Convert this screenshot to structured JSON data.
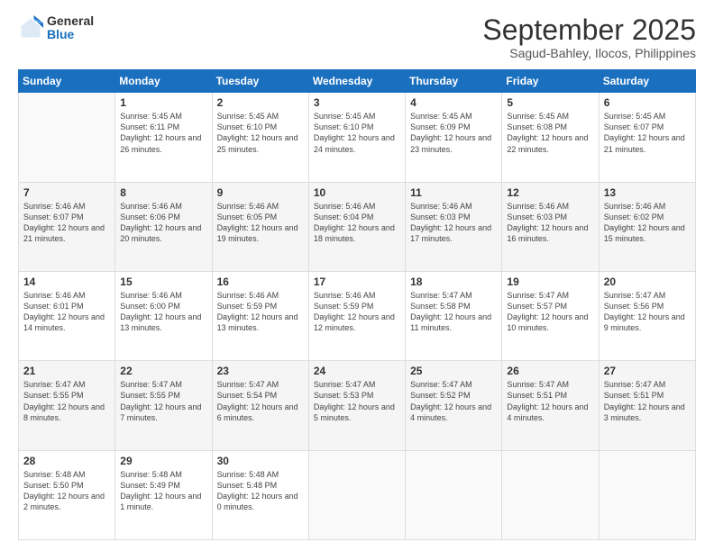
{
  "header": {
    "logo": {
      "line1": "General",
      "line2": "Blue"
    },
    "title": "September 2025",
    "subtitle": "Sagud-Bahley, Ilocos, Philippines"
  },
  "columns": [
    "Sunday",
    "Monday",
    "Tuesday",
    "Wednesday",
    "Thursday",
    "Friday",
    "Saturday"
  ],
  "weeks": [
    [
      {
        "day": "",
        "sunrise": "",
        "sunset": "",
        "daylight": ""
      },
      {
        "day": "1",
        "sunrise": "Sunrise: 5:45 AM",
        "sunset": "Sunset: 6:11 PM",
        "daylight": "Daylight: 12 hours and 26 minutes."
      },
      {
        "day": "2",
        "sunrise": "Sunrise: 5:45 AM",
        "sunset": "Sunset: 6:10 PM",
        "daylight": "Daylight: 12 hours and 25 minutes."
      },
      {
        "day": "3",
        "sunrise": "Sunrise: 5:45 AM",
        "sunset": "Sunset: 6:10 PM",
        "daylight": "Daylight: 12 hours and 24 minutes."
      },
      {
        "day": "4",
        "sunrise": "Sunrise: 5:45 AM",
        "sunset": "Sunset: 6:09 PM",
        "daylight": "Daylight: 12 hours and 23 minutes."
      },
      {
        "day": "5",
        "sunrise": "Sunrise: 5:45 AM",
        "sunset": "Sunset: 6:08 PM",
        "daylight": "Daylight: 12 hours and 22 minutes."
      },
      {
        "day": "6",
        "sunrise": "Sunrise: 5:45 AM",
        "sunset": "Sunset: 6:07 PM",
        "daylight": "Daylight: 12 hours and 21 minutes."
      }
    ],
    [
      {
        "day": "7",
        "sunrise": "Sunrise: 5:46 AM",
        "sunset": "Sunset: 6:07 PM",
        "daylight": "Daylight: 12 hours and 21 minutes."
      },
      {
        "day": "8",
        "sunrise": "Sunrise: 5:46 AM",
        "sunset": "Sunset: 6:06 PM",
        "daylight": "Daylight: 12 hours and 20 minutes."
      },
      {
        "day": "9",
        "sunrise": "Sunrise: 5:46 AM",
        "sunset": "Sunset: 6:05 PM",
        "daylight": "Daylight: 12 hours and 19 minutes."
      },
      {
        "day": "10",
        "sunrise": "Sunrise: 5:46 AM",
        "sunset": "Sunset: 6:04 PM",
        "daylight": "Daylight: 12 hours and 18 minutes."
      },
      {
        "day": "11",
        "sunrise": "Sunrise: 5:46 AM",
        "sunset": "Sunset: 6:03 PM",
        "daylight": "Daylight: 12 hours and 17 minutes."
      },
      {
        "day": "12",
        "sunrise": "Sunrise: 5:46 AM",
        "sunset": "Sunset: 6:03 PM",
        "daylight": "Daylight: 12 hours and 16 minutes."
      },
      {
        "day": "13",
        "sunrise": "Sunrise: 5:46 AM",
        "sunset": "Sunset: 6:02 PM",
        "daylight": "Daylight: 12 hours and 15 minutes."
      }
    ],
    [
      {
        "day": "14",
        "sunrise": "Sunrise: 5:46 AM",
        "sunset": "Sunset: 6:01 PM",
        "daylight": "Daylight: 12 hours and 14 minutes."
      },
      {
        "day": "15",
        "sunrise": "Sunrise: 5:46 AM",
        "sunset": "Sunset: 6:00 PM",
        "daylight": "Daylight: 12 hours and 13 minutes."
      },
      {
        "day": "16",
        "sunrise": "Sunrise: 5:46 AM",
        "sunset": "Sunset: 5:59 PM",
        "daylight": "Daylight: 12 hours and 13 minutes."
      },
      {
        "day": "17",
        "sunrise": "Sunrise: 5:46 AM",
        "sunset": "Sunset: 5:59 PM",
        "daylight": "Daylight: 12 hours and 12 minutes."
      },
      {
        "day": "18",
        "sunrise": "Sunrise: 5:47 AM",
        "sunset": "Sunset: 5:58 PM",
        "daylight": "Daylight: 12 hours and 11 minutes."
      },
      {
        "day": "19",
        "sunrise": "Sunrise: 5:47 AM",
        "sunset": "Sunset: 5:57 PM",
        "daylight": "Daylight: 12 hours and 10 minutes."
      },
      {
        "day": "20",
        "sunrise": "Sunrise: 5:47 AM",
        "sunset": "Sunset: 5:56 PM",
        "daylight": "Daylight: 12 hours and 9 minutes."
      }
    ],
    [
      {
        "day": "21",
        "sunrise": "Sunrise: 5:47 AM",
        "sunset": "Sunset: 5:55 PM",
        "daylight": "Daylight: 12 hours and 8 minutes."
      },
      {
        "day": "22",
        "sunrise": "Sunrise: 5:47 AM",
        "sunset": "Sunset: 5:55 PM",
        "daylight": "Daylight: 12 hours and 7 minutes."
      },
      {
        "day": "23",
        "sunrise": "Sunrise: 5:47 AM",
        "sunset": "Sunset: 5:54 PM",
        "daylight": "Daylight: 12 hours and 6 minutes."
      },
      {
        "day": "24",
        "sunrise": "Sunrise: 5:47 AM",
        "sunset": "Sunset: 5:53 PM",
        "daylight": "Daylight: 12 hours and 5 minutes."
      },
      {
        "day": "25",
        "sunrise": "Sunrise: 5:47 AM",
        "sunset": "Sunset: 5:52 PM",
        "daylight": "Daylight: 12 hours and 4 minutes."
      },
      {
        "day": "26",
        "sunrise": "Sunrise: 5:47 AM",
        "sunset": "Sunset: 5:51 PM",
        "daylight": "Daylight: 12 hours and 4 minutes."
      },
      {
        "day": "27",
        "sunrise": "Sunrise: 5:47 AM",
        "sunset": "Sunset: 5:51 PM",
        "daylight": "Daylight: 12 hours and 3 minutes."
      }
    ],
    [
      {
        "day": "28",
        "sunrise": "Sunrise: 5:48 AM",
        "sunset": "Sunset: 5:50 PM",
        "daylight": "Daylight: 12 hours and 2 minutes."
      },
      {
        "day": "29",
        "sunrise": "Sunrise: 5:48 AM",
        "sunset": "Sunset: 5:49 PM",
        "daylight": "Daylight: 12 hours and 1 minute."
      },
      {
        "day": "30",
        "sunrise": "Sunrise: 5:48 AM",
        "sunset": "Sunset: 5:48 PM",
        "daylight": "Daylight: 12 hours and 0 minutes."
      },
      {
        "day": "",
        "sunrise": "",
        "sunset": "",
        "daylight": ""
      },
      {
        "day": "",
        "sunrise": "",
        "sunset": "",
        "daylight": ""
      },
      {
        "day": "",
        "sunrise": "",
        "sunset": "",
        "daylight": ""
      },
      {
        "day": "",
        "sunrise": "",
        "sunset": "",
        "daylight": ""
      }
    ]
  ]
}
